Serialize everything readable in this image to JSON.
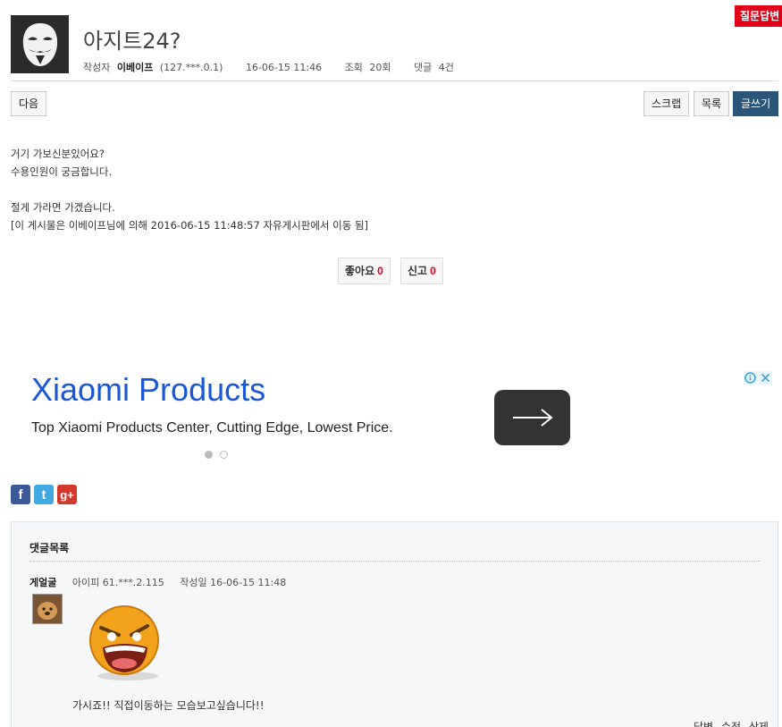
{
  "top_badge": "질문답변",
  "post": {
    "title": "아지트24?",
    "meta": {
      "author_label": "작성자",
      "author": "이베이프",
      "ip": "(127.***.0.1)",
      "datetime": "16-06-15 11:46",
      "views_label": "조회",
      "views": "20회",
      "comments_label": "댓글",
      "comments": "4건"
    },
    "body_lines": [
      "거기 가보신분있어요?",
      "수용인원이 궁금합니다.",
      "",
      "절게 가라면 가겠습니다.",
      "[이 게시물은 이베이프님에 의해 2016-06-15 11:48:57 자유게시판에서 이동 됨]"
    ]
  },
  "toolbar": {
    "next_label": "다음",
    "scrap_label": "스크랩",
    "list_label": "목록",
    "write_label": "글쓰기"
  },
  "votes": {
    "like_label": "좋아요",
    "like_count": "0",
    "report_label": "신고",
    "report_count": "0"
  },
  "ad": {
    "title": "Xiaomi Products",
    "description": "Top Xiaomi Products Center, Cutting Edge, Lowest Price.",
    "arrow_icon": "arrow-right-icon",
    "dots_active_index": 0,
    "dots_total": 2
  },
  "social": [
    {
      "name": "facebook-icon",
      "glyph": "f",
      "color": "#3b5998"
    },
    {
      "name": "twitter-icon",
      "glyph": "t",
      "color": "#3fa9e0"
    },
    {
      "name": "googleplus-icon",
      "glyph": "g+",
      "color": "#d2382c"
    }
  ],
  "comments_section": {
    "heading": "댓글목록",
    "items": [
      {
        "nickname": "게얼굴",
        "ip_label": "아이피",
        "ip": "61.***.2.115",
        "date_label": "작성일",
        "date": "16-06-15 11:48",
        "text": "가시죠!!  직접이동하는 모습보고싶습니다!!",
        "actions": [
          "답변",
          "수정",
          "삭제"
        ]
      }
    ]
  },
  "colors": {
    "accent_blue": "#2a5579",
    "count_red": "#e0001a",
    "ad_title_blue": "#1a57d6"
  }
}
